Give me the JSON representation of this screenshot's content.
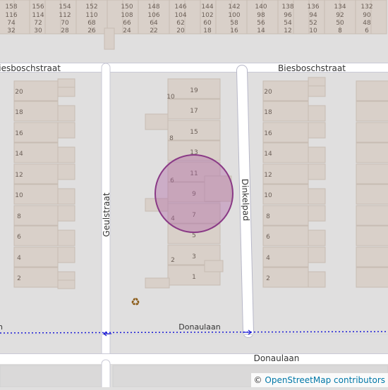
{
  "map": {
    "colors": {
      "background": "#e0dfdf",
      "building": "#d9d0c9",
      "building_edge": "#c7bcb3",
      "road_fill": "#ffffff",
      "road_edge": "#c9c9d6",
      "path_edge": "#b7b7c8",
      "route": "#1a1ad6",
      "marker_fill": "#b06aa8",
      "marker_stroke": "#8a3a86",
      "label": "#333333",
      "house_number": "#6b5f57"
    },
    "streets": [
      {
        "id": "biesboschstraat-left",
        "name": "Biesboschstraat"
      },
      {
        "id": "biesboschstraat-right",
        "name": "Biesboschstraat"
      },
      {
        "id": "geulstraat",
        "name": "Geulstraat"
      },
      {
        "id": "dinkelpad",
        "name": "Dinkelpad"
      },
      {
        "id": "donaulaan-bus",
        "name": "Donaulaan"
      },
      {
        "id": "donaulaan-left-stub",
        "name": "Donaulaan"
      },
      {
        "id": "donaulaan-road",
        "name": "Donaulaan"
      }
    ],
    "top_numbers": [
      {
        "top": "158",
        "mid": "116",
        "bottom": "74"
      },
      {
        "top": "156",
        "mid": "114",
        "bottom": "72",
        "row4": "30"
      },
      {
        "top": "154",
        "mid": "112",
        "bottom": "70",
        "row4": "28"
      },
      {
        "top": "152",
        "mid": "110",
        "bottom": "68",
        "row4": "26"
      },
      {
        "top": "150",
        "mid": "108",
        "bottom": "66",
        "row4": "24"
      },
      {
        "top": "148",
        "mid": "106",
        "bottom": "64",
        "row4": "22"
      },
      {
        "top": "146",
        "mid": "104",
        "bottom": "62",
        "row4": "20"
      },
      {
        "top": "144",
        "mid": "102",
        "bottom": "60",
        "row4": "18"
      },
      {
        "top": "142",
        "mid": "100",
        "bottom": "58",
        "row4": "16"
      },
      {
        "top": "140",
        "mid": "98",
        "bottom": "56",
        "row4": "14"
      },
      {
        "top": "138",
        "mid": "96",
        "bottom": "54",
        "row4": "12"
      },
      {
        "top": "136",
        "mid": "94",
        "bottom": "52",
        "row4": "10"
      },
      {
        "top": "134",
        "mid": "92",
        "bottom": "50",
        "row4": "8"
      },
      {
        "top": "132",
        "mid": "90",
        "bottom": "48",
        "row4": "6"
      }
    ],
    "top_first_row4": "32",
    "left_block_numbers": [
      "20",
      "18",
      "16",
      "14",
      "12",
      "10",
      "8",
      "6",
      "4",
      "2"
    ],
    "right_block_numbers": [
      "20",
      "18",
      "16",
      "14",
      "12",
      "10",
      "8",
      "6",
      "4",
      "2"
    ],
    "middle_odd_numbers": [
      "19",
      "17",
      "15",
      "13",
      "11",
      "9",
      "7",
      "5",
      "3",
      "1"
    ],
    "middle_even_numbers": [
      "10",
      "8",
      "6",
      "4",
      "2"
    ],
    "poi": {
      "name": "recycling-icon",
      "glyph": "♻"
    },
    "marker": {
      "name": "location-marker"
    }
  },
  "attribution": {
    "copyright": "©",
    "link": "OpenStreetMap contributors"
  }
}
